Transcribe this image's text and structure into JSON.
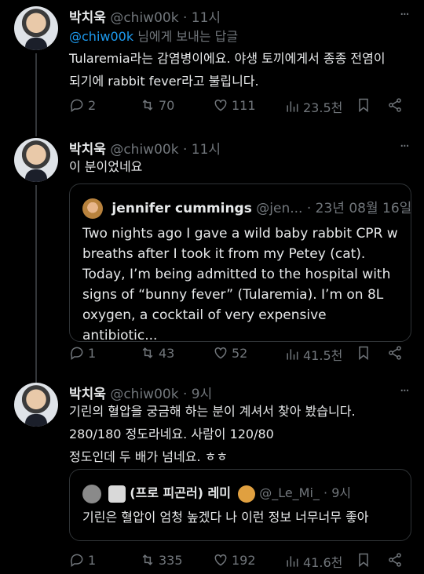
{
  "tweets": [
    {
      "name": "박치욱",
      "handle": "@chiw00k",
      "time": "11시",
      "reply_to_mention": "@chiw00k",
      "reply_to_suffix": "님에게 보내는 답글",
      "text_line1": "Tularemia라는 감염병이에요. 야생 토끼에게서 종종 전염이",
      "text_line2": "되기에 rabbit fever라고 불립니다.",
      "replies": "2",
      "retweets": "70",
      "likes": "111",
      "views": "23.5천"
    },
    {
      "name": "박치욱",
      "handle": "@chiw00k",
      "time": "11시",
      "text_line1": "이 분이었네요",
      "quote": {
        "name": "jennifer cummings",
        "handle": "@jen...",
        "time": "23년 08월 16일",
        "line1": "Two nights ago I gave a wild baby rabbit CPR w",
        "line2": "breaths after I took it from my Petey (cat).",
        "line3": "Today, I’m being admitted to the hospital with",
        "line4": "signs of “bunny fever” (Tularemia). I’m on 8L",
        "line5": "oxygen, a cocktail of very expensive antibiotic..."
      },
      "replies": "1",
      "retweets": "43",
      "likes": "52",
      "views": "41.5천"
    },
    {
      "name": "박치욱",
      "handle": "@chiw00k",
      "time": "9시",
      "text_line1": "기린의 혈압을 궁금해 하는 분이 계셔서 찾아 봤습니다.",
      "text_line2": "280/180 정도라네요. 사람이 120/80",
      "text_line3": "정도인데 두 배가 넘네요. ㅎㅎ",
      "quote": {
        "name": "(프로 피곤러) 레미",
        "handle": "@_Le_Mi_",
        "time": "9시",
        "line1": "기린은 혈압이 엄청 높겠다 나 이런 정보 너무너무 좋아"
      },
      "replies": "1",
      "retweets": "335",
      "likes": "192",
      "views": "41.6천"
    }
  ],
  "dot": "·",
  "more_label": "···"
}
